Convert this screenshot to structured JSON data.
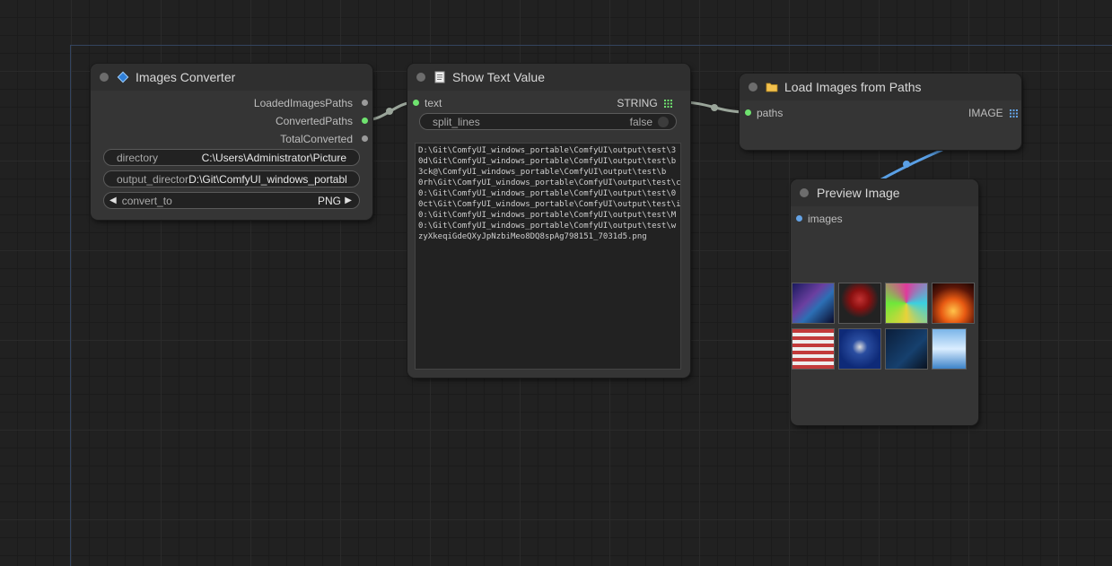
{
  "nodes": {
    "images_converter": {
      "title": "Images Converter",
      "outputs": [
        "LoadedImagesPaths",
        "ConvertedPaths",
        "TotalConverted"
      ],
      "widgets": {
        "directory": {
          "label": "directory",
          "value": "C:\\Users\\Administrator\\Picture"
        },
        "output_directory": {
          "label": "output_director",
          "value": "D:\\Git\\ComfyUI_windows_portabl"
        },
        "convert_to": {
          "label": "convert_to",
          "value": "PNG"
        }
      }
    },
    "show_text_value": {
      "title": "Show Text Value",
      "input_label": "text",
      "output_label": "STRING",
      "split_lines": {
        "label": "split_lines",
        "value": "false"
      },
      "text_lines": [
        "D:\\Git\\ComfyUI_windows_portable\\ComfyUI\\output\\test\\3",
        "0d\\Git\\ComfyUI_windows_portable\\ComfyUI\\output\\test\\b",
        "3ck@\\ComfyUI_windows_portable\\ComfyUI\\output\\test\\b",
        "0rh\\Git\\ComfyUI_windows_portable\\ComfyUI\\output\\test\\c",
        "0:\\Git\\ComfyUI_windows_portable\\ComfyUI\\output\\test\\0",
        "0ct\\Git\\ComfyUI_windows_portable\\ComfyUI\\output\\test\\i",
        "0:\\Git\\ComfyUI_windows_portable\\ComfyUI\\output\\test\\M",
        "0:\\Git\\ComfyUI_windows_portable\\ComfyUI\\output\\test\\w",
        "zyXkeqiGdeQXyJpNzbiMeo8DQ8spAg798151_7031d5.png"
      ]
    },
    "load_images": {
      "title": "Load Images from Paths",
      "input_label": "paths",
      "output_label": "IMAGE"
    },
    "preview_image": {
      "title": "Preview Image",
      "input_label": "images",
      "thumbnails": [
        "galaxy",
        "speaker-red",
        "spiral",
        "fire",
        "podium-flag",
        "podium-blue",
        "prime-time",
        "sky-clouds"
      ]
    }
  },
  "colors": {
    "link_gray": "#9aa59a",
    "link_blue": "#5aa0e6",
    "slot_green": "#6fe36f",
    "slot_blue": "#64a3e6",
    "group_border": "#33445f"
  },
  "icons": {
    "images_converter": "blue-diamond-icon",
    "show_text_value": "document-icon",
    "load_images": "folder-icon"
  }
}
